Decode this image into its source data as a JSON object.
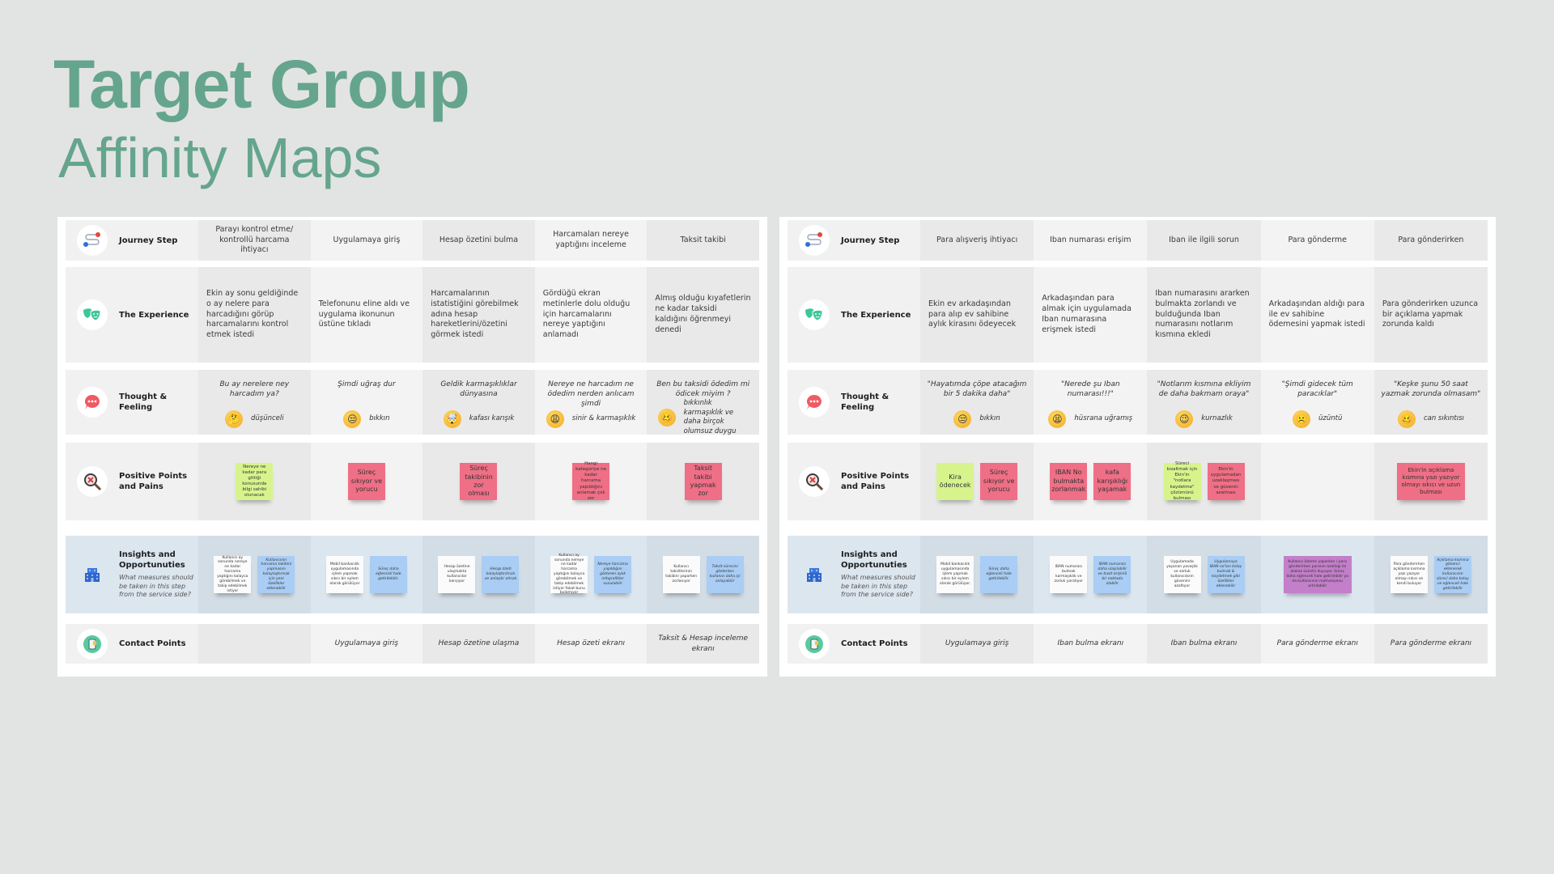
{
  "title": {
    "line1": "Target Group",
    "line2": "Affinity Maps"
  },
  "colors": {
    "accent": "#65a58d",
    "sticky_green": "#d7f48c",
    "sticky_red": "#ef6f86",
    "sticky_blue": "#a9cdf4",
    "sticky_purple": "#c37fc9",
    "insight_row": "#dce6ef"
  },
  "row_labels": {
    "journey": "Journey Step",
    "experience": "The Experience",
    "thought": "Thought & Feeling",
    "positive": "Positive Points and Pains",
    "insights": "Insights and Opportunuties",
    "insights_sub": "What measures should be taken in this step from the service side?",
    "contact": "Contact Points"
  },
  "row_icons": [
    "route-icon",
    "theater-masks-icon",
    "chat-bubble-icon",
    "magnifier-x-icon",
    "building-icon",
    "phone-icon"
  ],
  "maps": [
    {
      "steps": [
        "Parayı kontrol etme/ kontrollü harcama ihtiyacı",
        "Uygulamaya giriş",
        "Hesap özetini bulma",
        "Harcamaları nereye yaptığını inceleme",
        "Taksit takibi"
      ],
      "experience": [
        "Ekin ay sonu geldiğinde o ay nelere para harcadığını görüp harcamalarını kontrol etmek istedi",
        "Telefonunu eline aldı ve uygulama ikonunun üstüne tıkladı",
        "Harcamalarının istatistiğini görebilmek adına hesap hareketlerini/özetini görmek istedi",
        "Gördüğü ekran metinlerle dolu olduğu için harcamalarını nereye yaptığını anlamadı",
        "Almış olduğu kıyafetlerin ne kadar taksidi kaldığını öğrenmeyi denedi"
      ],
      "thoughts": [
        {
          "quote": "Bu ay nerelere ney harcadım ya?",
          "emoji": "🤔",
          "feeling": "düşünceli"
        },
        {
          "quote": "Şimdi uğraş dur",
          "emoji": "😒",
          "feeling": "bıkkın"
        },
        {
          "quote": "Geldik karmaşıklıklar dünyasına",
          "emoji": "🤯",
          "feeling": "kafası karışık"
        },
        {
          "quote": "Nereye ne harcadım ne ödedim nerden anlıcam şimdi",
          "emoji": "😩",
          "feeling": "sinir & karmaşıklık"
        },
        {
          "quote": "Ben bu taksidi ödedim mi ödicek miyim ?",
          "emoji": "🥴",
          "feeling": "bıkkınlık karmaşıklık ve daha birçok olumsuz duygu"
        }
      ],
      "points": [
        [
          {
            "text": "Nereye ne kadar para gittiği konusunda bilgi sahibi olunacak",
            "color": "green"
          }
        ],
        [
          {
            "text": "Süreç sıkıyor ve yorucu",
            "color": "red"
          }
        ],
        [
          {
            "text": "Süreç takibinin zor olması",
            "color": "red"
          }
        ],
        [
          {
            "text": "Hangi kategoriye ne kadar harcama yapıldığını anlamak çok zor",
            "color": "red"
          }
        ],
        [
          {
            "text": "Taksit takibi yapmak zor",
            "color": "red"
          }
        ]
      ],
      "insights": [
        [
          {
            "text": "Kullanıcı ay sonunda nereye ne kadar harcama yaptığını kolayca görebilmek ve takip edebilmek istiyor",
            "color": "white"
          },
          {
            "text": "Kullanıcının harcama takibini yapmasını kolaylaştırmak için yeni özellikler eklenebilir",
            "color": "blue"
          }
        ],
        [
          {
            "text": "Mobil bankacılık uygulamasında işlem yapmak sıkıcı bir eylem olarak görülüyor",
            "color": "white"
          },
          {
            "text": "Süreç daha eğlenceli hale getirilebilir.",
            "color": "blue"
          }
        ],
        [
          {
            "text": "Hesap özetine ulaşmakta kullanıcılar karışıyor",
            "color": "white"
          },
          {
            "text": "Hesap özeti kolaylaştırılmalı ve anlaşılır olmalı",
            "color": "blue"
          }
        ],
        [
          {
            "text": "Kullanıcı ay sonunda nereye ne kadar harcama yaptığını kolayca görebilmek ve takip edebilmek istiyor fakat bunu bulamıyor",
            "color": "white"
          },
          {
            "text": "Nereye harcama yapıldığını gösteren aylık infografikler sunulabilir",
            "color": "blue"
          }
        ],
        [
          {
            "text": "Kullanıcı taksitlerinin takibini yaparken zorlanıyor",
            "color": "white"
          },
          {
            "text": "Taksit sürecini gösterilen kullanıcı daha iyi anlayabilir",
            "color": "blue"
          }
        ]
      ],
      "contacts": [
        "",
        "Uygulamaya giriş",
        "Hesap özetine ulaşma",
        "Hesap özeti ekranı",
        "Taksit & Hesap inceleme ekranı"
      ]
    },
    {
      "steps": [
        "Para alışveriş ihtiyacı",
        "Iban numarası erişim",
        "Iban ile ilgili sorun",
        "Para gönderme",
        "Para gönderirken"
      ],
      "experience": [
        "Ekin ev arkadaşından para alıp ev sahibine aylık kirasını ödeyecek",
        "Arkadaşından para almak için uygulamada Iban numarasına erişmek istedi",
        "Iban numarasını ararken bulmakta zorlandı ve bulduğunda Iban numarasını notlarım kısmına ekledi",
        "Arkadaşından aldığı para ile ev sahibine ödemesini yapmak istedi",
        "Para gönderirken uzunca bir açıklama yapmak zorunda kaldı"
      ],
      "thoughts": [
        {
          "quote": "\"Hayatımda çöpe atacağım bir 5 dakika daha\"",
          "emoji": "😒",
          "feeling": "bıkkın"
        },
        {
          "quote": "\"Nerede şu Iban numarası!!!\"",
          "emoji": "😫",
          "feeling": "hüsrana uğramış"
        },
        {
          "quote": "\"Notlarım kısmına ekliyim de daha bakmam oraya\"",
          "emoji": "😉",
          "feeling": "kurnazlık"
        },
        {
          "quote": "\"Şimdi gidecek tüm paracıklar\"",
          "emoji": "☹️",
          "feeling": "üzüntü"
        },
        {
          "quote": "\"Keşke şunu 50 saat yazmak zorunda olmasam\"",
          "emoji": "🥴",
          "feeling": "can sıkıntısı"
        }
      ],
      "points": [
        [
          {
            "text": "Kira ödenecek",
            "color": "green"
          },
          {
            "text": "Süreç sıkıyor ve yorucu",
            "color": "red"
          }
        ],
        [
          {
            "text": "IBAN No bulmakta zorlanmak",
            "color": "red"
          },
          {
            "text": "kafa karışıklığı yaşamak",
            "color": "red"
          }
        ],
        [
          {
            "text": "Süreci kısaltmak için Ekin'in \"notlara kaydetme\" çözümünü bulması",
            "color": "green"
          },
          {
            "text": "Ekin'in uygulamadan uzaklaşması ve güvenin azalması",
            "color": "red"
          }
        ],
        [],
        [
          {
            "text": "Ekin'in açıklama kısmına yazı yazıyor olmayı sıkıcı ve uzun bulması",
            "color": "red",
            "wide": true
          }
        ]
      ],
      "insights": [
        [
          {
            "text": "Mobil bankacılık uygulamasında işlem yapmak sıkıcı bir eylem olarak görülüyor.",
            "color": "white"
          },
          {
            "text": "Süreç daha eğlenceli hale getirilebilir.",
            "color": "blue"
          }
        ],
        [
          {
            "text": "IBAN numarası bulmak karmaşıklık ve zorluk yaratıyor",
            "color": "white"
          },
          {
            "text": "IBAN numarası daha ulaşılabilir ve basit erişimli bir noktada olabilir",
            "color": "blue"
          }
        ],
        [
          {
            "text": "Uygulamada yaşanan yavaşlık ve zorluk kullanıcıların güvenini azaltıyor",
            "color": "white"
          },
          {
            "text": "Uygulamaya IBAN no'ları kolay bulmak & kaydetmek gibi özellikler eklenebilir",
            "color": "blue"
          }
        ],
        [
          {
            "text": "Kullanıcı ödeme yaparken / para gönderirken paranın azaldığı ile alakalı üzüntü duyuyor. Süreç daha eğlenceli hale getirilebilir ya da kullanıcının motivasyonu artırılabilir",
            "color": "purple",
            "wide": true
          }
        ],
        [
          {
            "text": "Para gönderirken açıklama kısmına yazı yazıyor olmayı sıkıcı ve kendi buluyor",
            "color": "white"
          },
          {
            "text": "Açıklama kısmına gönenci eklenerek kullanıcının süreci daha kolay ve eğlenceli hale getirilebilir",
            "color": "blue"
          }
        ]
      ],
      "contacts": [
        "Uygulamaya giriş",
        "Iban bulma ekranı",
        "Iban bulma ekranı",
        "Para gönderme ekranı",
        "Para gönderme ekranı"
      ]
    }
  ]
}
